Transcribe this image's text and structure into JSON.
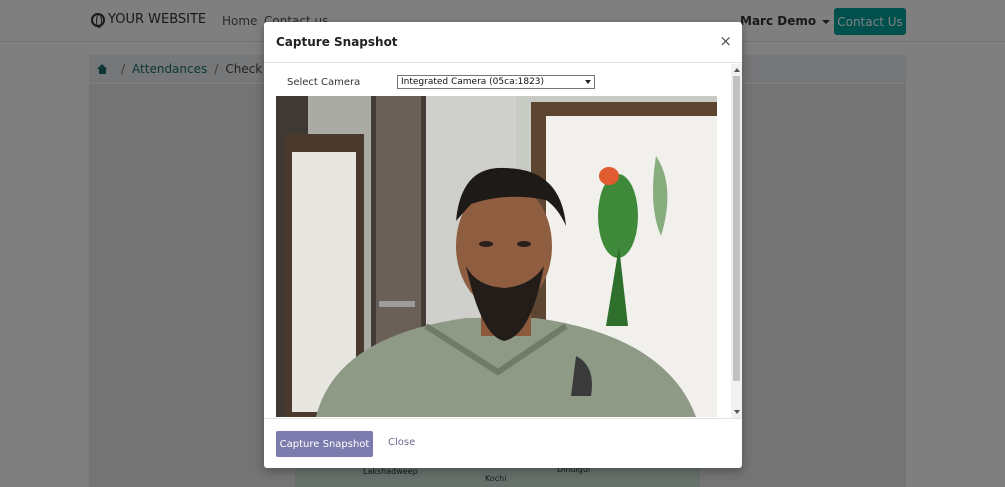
{
  "navbar": {
    "brand": "YOUR WEBSITE",
    "links": [
      "Home",
      "Contact us"
    ],
    "user": "Marc Demo",
    "contact_button": "Contact Us"
  },
  "breadcrumb": {
    "items": [
      "Attendances",
      "Check In o"
    ]
  },
  "map": {
    "labels": [
      "Lakshadweep",
      "Dindigul",
      "Kochi"
    ]
  },
  "modal": {
    "title": "Capture Snapshot",
    "close_symbol": "×",
    "camera_label": "Select Camera",
    "camera_selected": "Integrated Camera (05ca:1823)",
    "capture_button": "Capture Snapshot",
    "close_button": "Close"
  },
  "colors": {
    "accent": "#00A09D",
    "capture_button": "#7c7bad",
    "link": "#1a6f6f"
  },
  "icons": [
    "globe-icon",
    "home-icon",
    "close-icon",
    "caret-down-icon"
  ]
}
